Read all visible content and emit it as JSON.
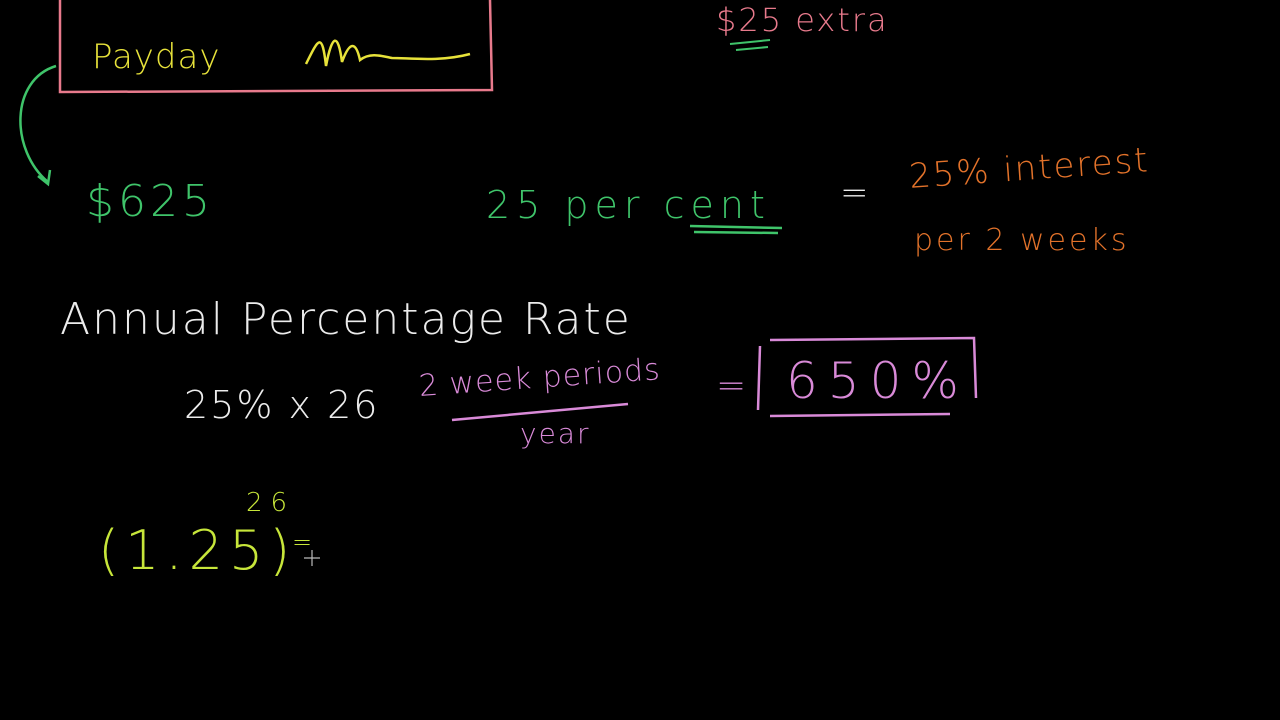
{
  "colors": {
    "background": "#000000",
    "green": "#3fc46a",
    "yellow": "#e7e23a",
    "orange": "#e2722a",
    "pink": "#d98ad8",
    "white": "#ececec",
    "lime": "#c7e63a",
    "red": "#e87a8c"
  },
  "box_top": {
    "payday_label": "Payday",
    "signature": "Mm"
  },
  "top_right": {
    "extra": "$25 extra"
  },
  "left": {
    "amount": "$625"
  },
  "percent_line": {
    "left": "25 per cent",
    "equals": "=",
    "right_line1": "25% interest",
    "right_line2": "per 2 weeks"
  },
  "apr": {
    "title": "Annual Percentage Rate",
    "calc_prefix": "25% x 26",
    "calc_periods_num": "2 week periods",
    "calc_periods_den": "year",
    "calc_equals": "=",
    "result": "650%"
  },
  "compound": {
    "base": "(1.25)",
    "exponent": "26",
    "equals": "="
  }
}
